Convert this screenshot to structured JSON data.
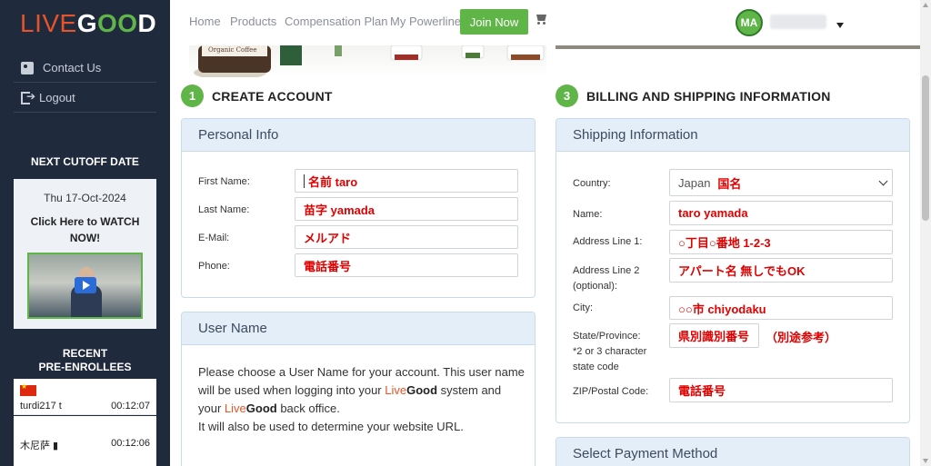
{
  "brand": {
    "logo_live": "LIVE",
    "logo_g": "G",
    "logo_oo": "OO",
    "logo_d": "D"
  },
  "sidebar": {
    "links": [
      {
        "label": "Contact Us",
        "icon": "contact-card-icon"
      },
      {
        "label": "Logout",
        "icon": "logout-icon"
      }
    ],
    "cutoff": {
      "title": "NEXT CUTOFF DATE",
      "date": "Thu 17-Oct-2024",
      "watch_line1": "Click Here to WATCH",
      "watch_line2": "NOW!"
    },
    "recent": {
      "title_line1": "RECENT",
      "title_line2": "PRE-ENROLLEES",
      "items": [
        {
          "name": "turdi217 t",
          "time": "00:12:07",
          "flag": "china-flag-icon"
        },
        {
          "name": "木尼萨 ▮",
          "time": "00:12:06"
        }
      ]
    }
  },
  "nav": {
    "items": [
      "Home",
      "Products",
      "Compensation Plan",
      "My Powerline"
    ],
    "join_label": "Join Now",
    "avatar_initials": "MA"
  },
  "banner": {
    "product_label": "Organic Coffee"
  },
  "sections": {
    "create": {
      "step": "1",
      "title": "CREATE ACCOUNT"
    },
    "billing": {
      "step": "3",
      "title": "BILLING AND SHIPPING INFORMATION"
    }
  },
  "personal": {
    "heading": "Personal Info",
    "fields": [
      {
        "label": "First Name:",
        "value": "名前  taro"
      },
      {
        "label": "Last Name:",
        "value": "苗字  yamada"
      },
      {
        "label": "E-Mail:",
        "value": "メルアド"
      },
      {
        "label": "Phone:",
        "value": "電話番号"
      }
    ]
  },
  "username": {
    "heading": "User Name",
    "para1": "Please choose a User Name for your account. This user name will be used when logging into your ",
    "brand_live": "Live",
    "brand_good": "Good",
    "para2": " system and your ",
    "para3": " back office.",
    "para4": "It will also be used to determine your website URL."
  },
  "shipping": {
    "heading": "Shipping Information",
    "country_label": "Country:",
    "country_value": "Japan",
    "country_note": "国名",
    "fields": [
      {
        "label": "Name:",
        "value": "taro yamada"
      },
      {
        "label": "Address Line 1:",
        "value": "○丁目○番地  1-2-3"
      },
      {
        "label_line1": "Address Line 2",
        "label_line2": "(optional):",
        "value": "アパート名  無しでもOK"
      },
      {
        "label": "City:",
        "value": "○○市  chiyodaku"
      },
      {
        "label_line1": "State/Province:",
        "label_line2": "*2 or 3 character",
        "label_line3": "state code",
        "value": "県別識別番号",
        "note": "（別途参考）"
      },
      {
        "label": "ZIP/Postal Code:",
        "value": "電話番号"
      }
    ]
  },
  "payment": {
    "heading": "Select Payment Method"
  }
}
